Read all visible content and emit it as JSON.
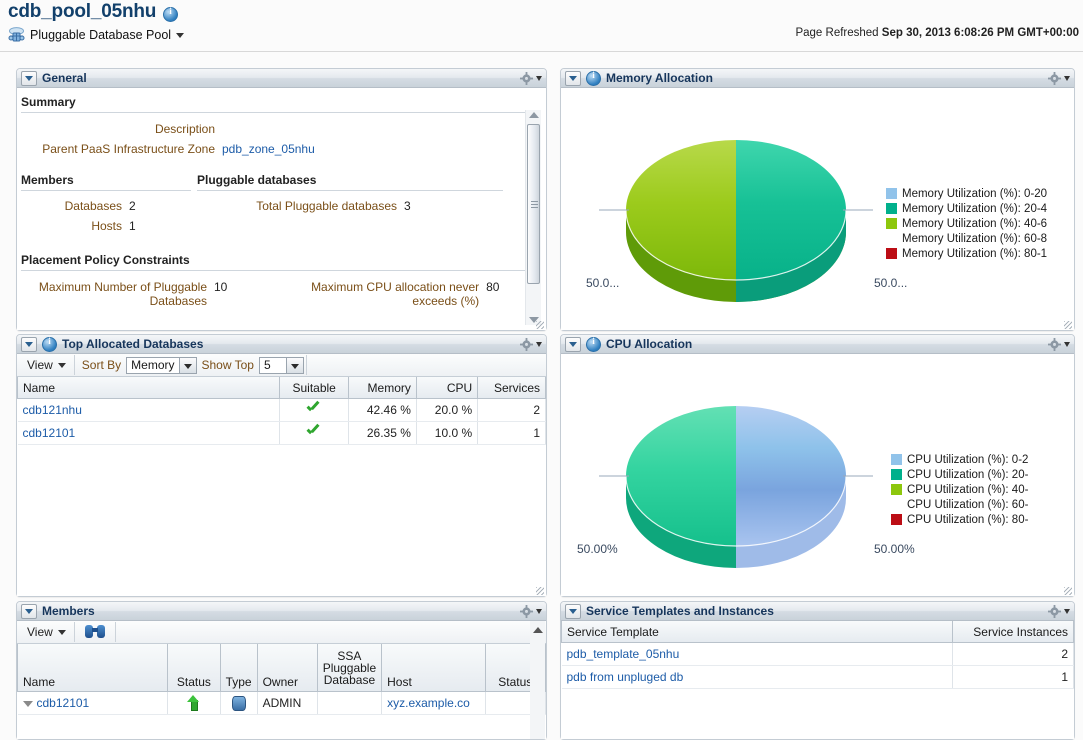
{
  "header": {
    "title": "cdb_pool_05nhu",
    "info_icon": "info-icon",
    "breadcrumb_label": "Pluggable Database Pool",
    "refreshed_label": "Page Refreshed",
    "refreshed_value": "Sep 30, 2013 6:08:26 PM GMT+00:00"
  },
  "general": {
    "panel_title": "General",
    "summary_title": "Summary",
    "summary_rows": [
      {
        "label": "Description",
        "value": "",
        "link": false
      },
      {
        "label": "Parent PaaS Infrastructure Zone",
        "value": "pdb_zone_05nhu",
        "link": true
      }
    ],
    "members_title": "Members",
    "members_rows": [
      {
        "label": "Databases",
        "value": "2"
      },
      {
        "label": "Hosts",
        "value": "1"
      }
    ],
    "pluggable_title": "Pluggable databases",
    "pluggable_rows": [
      {
        "label": "Total Pluggable databases",
        "value": "3"
      }
    ],
    "placement_title": "Placement Policy Constraints",
    "placement_rows_left": [
      {
        "label": "Maximum Number of Pluggable Databases",
        "value": "10"
      }
    ],
    "placement_rows_right": [
      {
        "label": "Maximum CPU allocation never exceeds (%)",
        "value": "80"
      }
    ]
  },
  "top_allocated": {
    "panel_title": "Top Allocated Databases",
    "toolbar": {
      "view_label": "View",
      "sort_by_label": "Sort By",
      "sort_by_value": "Memory",
      "show_top_label": "Show Top",
      "show_top_value": "5"
    },
    "columns": [
      "Name",
      "Suitable",
      "Memory",
      "CPU",
      "Services"
    ],
    "rows": [
      {
        "name": "cdb121nhu",
        "suitable": "yes",
        "memory": "42.46 %",
        "cpu": "20.0 %",
        "services": "2"
      },
      {
        "name": "cdb12101",
        "suitable": "yes",
        "memory": "26.35 %",
        "cpu": "10.0 %",
        "services": "1"
      }
    ]
  },
  "members_panel": {
    "panel_title": "Members",
    "toolbar": {
      "view_label": "View",
      "search_icon": "binoculars-icon"
    },
    "columns": [
      "Name",
      "Status",
      "Type",
      "Owner",
      "SSA Pluggable Database",
      "Host",
      "Status"
    ],
    "rows": [
      {
        "name": "cdb12101",
        "status": "up",
        "type": "database-icon",
        "owner": "ADMIN",
        "ssa_pdb": "",
        "host": "xyz.example.co",
        "status2": ""
      }
    ]
  },
  "service_templates": {
    "panel_title": "Service Templates and Instances",
    "columns": [
      "Service Template",
      "Service Instances"
    ],
    "rows": [
      {
        "template": "pdb_template_05nhu",
        "instances": "2"
      },
      {
        "template": "pdb from unpluged db",
        "instances": "1"
      }
    ]
  },
  "chart_data": [
    {
      "type": "pie",
      "title": "Memory Allocation",
      "panel_id": "memory",
      "labels": [
        "50.0...",
        "50.0..."
      ],
      "slices": [
        {
          "name": "Memory Utilization (%): 40-6",
          "value": 50.0,
          "color": "#8dc71e",
          "label": "50.0..."
        },
        {
          "name": "Memory Utilization (%): 20-4",
          "value": 50.0,
          "color": "#11bd94",
          "label": "50.0..."
        }
      ],
      "legend": [
        {
          "label": "Memory Utilization (%): 0-20",
          "color": "#91c3ea"
        },
        {
          "label": "Memory Utilization (%): 20-4",
          "color": "#00b08c"
        },
        {
          "label": "Memory Utilization (%): 40-6",
          "color": "#8dc70d"
        },
        {
          "label": "Memory Utilization (%): 60-8",
          "color": "#ffffff"
        },
        {
          "label": "Memory Utilization (%): 80-1",
          "color": "#bc0d15"
        }
      ],
      "legend_position": "right"
    },
    {
      "type": "pie",
      "title": "CPU Allocation",
      "panel_id": "cpu",
      "labels": [
        "50.00%",
        "50.00%"
      ],
      "slices": [
        {
          "name": "CPU Utilization (%): 20-",
          "value": 50.0,
          "color": "#2ecf9b",
          "label": "50.00%"
        },
        {
          "name": "CPU Utilization (%): 0-2",
          "value": 50.0,
          "color": "#92b6e8",
          "label": "50.00%"
        }
      ],
      "legend": [
        {
          "label": "CPU Utilization (%): 0-2",
          "color": "#91c3ea"
        },
        {
          "label": "CPU Utilization (%): 20-",
          "color": "#00b08c"
        },
        {
          "label": "CPU Utilization (%): 40-",
          "color": "#8dc70d"
        },
        {
          "label": "CPU Utilization (%): 60-",
          "color": "#ffffff"
        },
        {
          "label": "CPU Utilization (%): 80-",
          "color": "#bc0d15"
        }
      ],
      "legend_position": "right"
    }
  ]
}
